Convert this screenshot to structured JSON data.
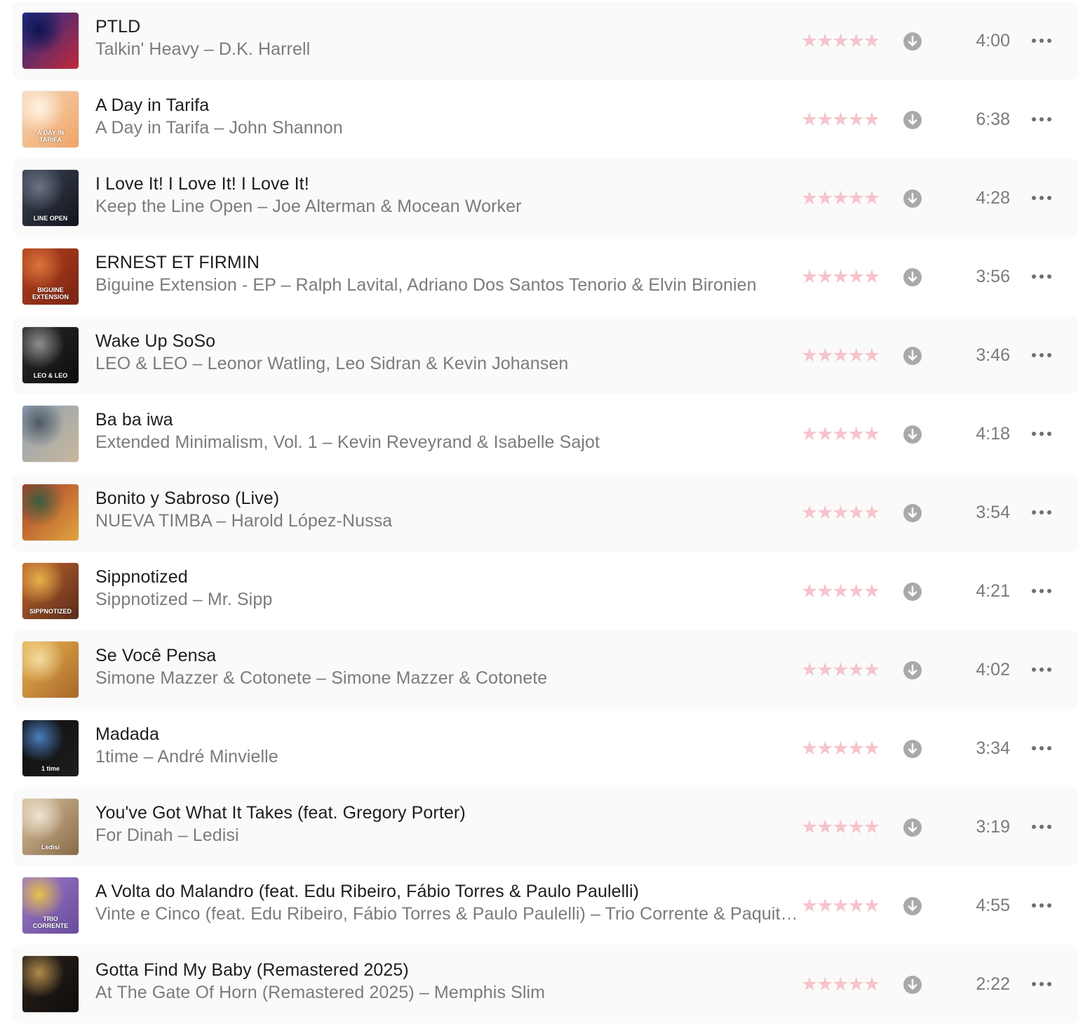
{
  "colors": {
    "row_shade": "#fafafa",
    "title": "#1d1d1f",
    "secondary": "#7b7b7f",
    "rating_star": "#f6c4cb",
    "download_circle": "#a9a9ad"
  },
  "icons": {
    "rating": "star-icon",
    "download": "download-arrow-circle-icon",
    "more": "ellipsis-icon"
  },
  "tracks": [
    {
      "title": "PTLD",
      "subtitle": "Talkin' Heavy – D.K. Harrell",
      "duration": "4:00",
      "stars": "★★★★★",
      "art_text": "",
      "art_colors": [
        "#1a2f8c",
        "#c2283a",
        "#0c1550"
      ]
    },
    {
      "title": "A Day in Tarifa",
      "subtitle": "A Day in Tarifa – John Shannon",
      "duration": "6:38",
      "stars": "★★★★★",
      "art_text": "A DAY IN TARIFA",
      "art_colors": [
        "#f7d7b5",
        "#f0a468",
        "#fff3e3"
      ]
    },
    {
      "title": "I Love It! I Love It! I Love It!",
      "subtitle": "Keep the Line Open – Joe Alterman & Mocean Worker",
      "duration": "4:28",
      "stars": "★★★★★",
      "art_text": "LINE OPEN",
      "art_colors": [
        "#3c4456",
        "#12151c",
        "#6b7384"
      ]
    },
    {
      "title": "ERNEST ET FIRMIN",
      "subtitle": "Biguine Extension - EP – Ralph Lavital, Adriano Dos Santos Tenorio & Elvin Bironien",
      "duration": "3:56",
      "stars": "★★★★★",
      "art_text": "BIGUINE EXTENSION",
      "art_colors": [
        "#b5411f",
        "#7a2412",
        "#d9743c"
      ]
    },
    {
      "title": "Wake Up SoSo",
      "subtitle": "LEO & LEO – Leonor Watling, Leo Sidran & Kevin Johansen",
      "duration": "3:46",
      "stars": "★★★★★",
      "art_text": "LEO & LEO",
      "art_colors": [
        "#2a2a2a",
        "#0d0d0d",
        "#8e8e8e"
      ]
    },
    {
      "title": "Ba ba iwa",
      "subtitle": "Extended Minimalism, Vol. 1 – Kevin Reveyrand & Isabelle Sajot",
      "duration": "4:18",
      "stars": "★★★★★",
      "art_text": "",
      "art_colors": [
        "#8fa3b6",
        "#c9b79a",
        "#4f5a66"
      ]
    },
    {
      "title": "Bonito y Sabroso (Live)",
      "subtitle": "NUEVA TIMBA – Harold López-Nussa",
      "duration": "3:54",
      "stars": "★★★★★",
      "art_text": "",
      "art_colors": [
        "#a93a2c",
        "#e0a53c",
        "#3b5c3f"
      ]
    },
    {
      "title": "Sippnotized",
      "subtitle": "Sippnotized – Mr. Sipp",
      "duration": "4:21",
      "stars": "★★★★★",
      "art_text": "SIPPNOTIZED",
      "art_colors": [
        "#c2682e",
        "#5a2a1a",
        "#e7b04a"
      ]
    },
    {
      "title": "Se Você Pensa",
      "subtitle": "Simone Mazzer & Cotonete – Simone Mazzer & Cotonete",
      "duration": "4:02",
      "stars": "★★★★★",
      "art_text": "",
      "art_colors": [
        "#e9b64e",
        "#a9662a",
        "#f2dca2"
      ]
    },
    {
      "title": "Madada",
      "subtitle": "1time – André Minvielle",
      "duration": "3:34",
      "stars": "★★★★★",
      "art_text": "1 time",
      "art_colors": [
        "#0d0d0d",
        "#1e1e1e",
        "#4a7dbf"
      ]
    },
    {
      "title": "You've Got What It Takes (feat. Gregory Porter)",
      "subtitle": "For Dinah – Ledisi",
      "duration": "3:19",
      "stars": "★★★★★",
      "art_text": "Ledisi",
      "art_colors": [
        "#d8c3a2",
        "#8a6a45",
        "#efe3cf"
      ]
    },
    {
      "title": "A Volta do Malandro (feat. Edu Ribeiro, Fábio Torres & Paulo Paulelli)",
      "subtitle": "Vinte e Cinco (feat. Edu Ribeiro, Fábio Torres & Paulo Paulelli) – Trio Corrente & Paquito D'Rivera",
      "duration": "4:55",
      "stars": "★★★★★",
      "art_text": "TRIO CORRENTE",
      "art_colors": [
        "#9a78c8",
        "#6a4c9c",
        "#e7c14a"
      ]
    },
    {
      "title": "Gotta Find My Baby (Remastered 2025)",
      "subtitle": "At The Gate Of Horn (Remastered 2025) – Memphis Slim",
      "duration": "2:22",
      "stars": "★★★★★",
      "art_text": "",
      "art_colors": [
        "#2a221c",
        "#0f0c0a",
        "#b08a4c"
      ]
    }
  ]
}
